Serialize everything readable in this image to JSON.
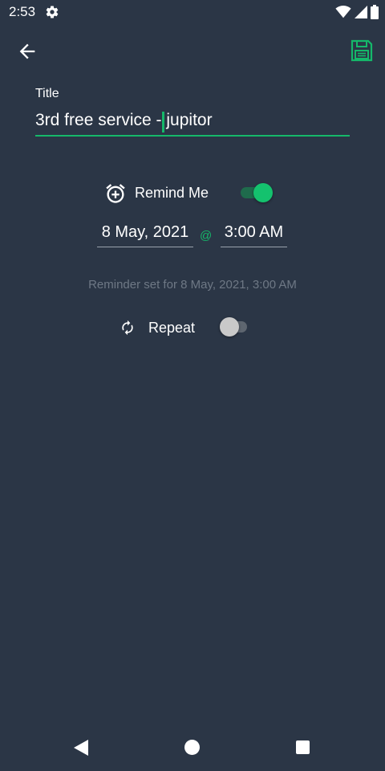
{
  "status_bar": {
    "time": "2:53",
    "icons": [
      "settings-gear-icon",
      "wifi-icon",
      "cell-signal-icon",
      "battery-icon"
    ]
  },
  "app_bar": {
    "back_icon": "arrow-left-icon",
    "save_icon": "floppy-disk-icon"
  },
  "form": {
    "title_label": "Title",
    "title_value": "3rd free service - jupitor",
    "remind_label": "Remind Me",
    "remind_enabled": true,
    "date_value": "8 May, 2021",
    "at_symbol": "@",
    "time_value": "3:00 AM",
    "reminder_summary": "Reminder set for 8 May, 2021, 3:00 AM",
    "repeat_label": "Repeat",
    "repeat_enabled": false
  },
  "nav_bar": {
    "icons": [
      "nav-back-icon",
      "nav-home-icon",
      "nav-recents-icon"
    ]
  },
  "colors": {
    "background": "#2b3646",
    "accent": "#15b86a",
    "muted_text": "#6e7885"
  }
}
